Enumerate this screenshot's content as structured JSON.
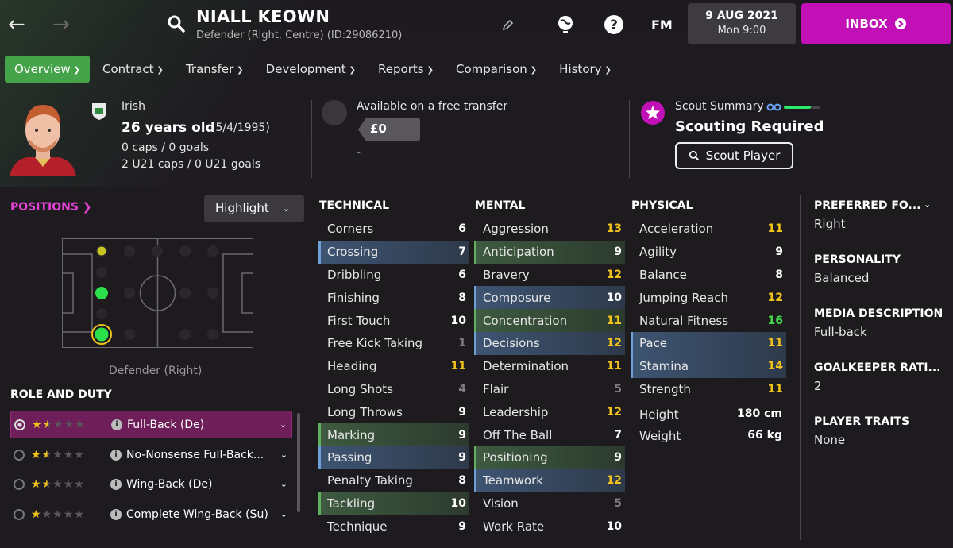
{
  "header": {
    "name": "NIALL KEOWN",
    "subtitle": "Defender (Right, Centre) (ID:29086210)",
    "fm_label": "FM",
    "date": "9 AUG 2021",
    "time": "Mon 9:00",
    "inbox": "INBOX"
  },
  "tabs": [
    {
      "label": "Overview",
      "active": true
    },
    {
      "label": "Contract"
    },
    {
      "label": "Transfer"
    },
    {
      "label": "Development"
    },
    {
      "label": "Reports"
    },
    {
      "label": "Comparison"
    },
    {
      "label": "History"
    }
  ],
  "bio": {
    "nationality": "Irish",
    "age": "26 years old",
    "dob": "(5/4/1995)",
    "caps": "0 caps / 0 goals",
    "u21": "2 U21 caps / 0 U21 goals"
  },
  "transfer": {
    "status": "Available on a free transfer",
    "value": "£0",
    "dash": "-"
  },
  "scout": {
    "label": "Scout Summary",
    "status": "Scouting Required",
    "button": "Scout Player"
  },
  "positions": {
    "title": "POSITIONS",
    "highlight": "Highlight",
    "position_name": "Defender (Right)"
  },
  "roles": {
    "title": "ROLE AND DUTY",
    "items": [
      {
        "name": "Full-Back (De)",
        "stars": 1.5,
        "selected": true
      },
      {
        "name": "No-Nonsense Full-Back...",
        "stars": 1.5
      },
      {
        "name": "Wing-Back (De)",
        "stars": 1.5
      },
      {
        "name": "Complete Wing-Back (Su)",
        "stars": 1
      }
    ]
  },
  "technical": {
    "title": "TECHNICAL",
    "rows": [
      {
        "n": "Corners",
        "v": "6"
      },
      {
        "n": "Crossing",
        "v": "7",
        "h": "b"
      },
      {
        "n": "Dribbling",
        "v": "6"
      },
      {
        "n": "Finishing",
        "v": "8"
      },
      {
        "n": "First Touch",
        "v": "10"
      },
      {
        "n": "Free Kick Taking",
        "v": "1",
        "c": "d"
      },
      {
        "n": "Heading",
        "v": "11",
        "c": "y"
      },
      {
        "n": "Long Shots",
        "v": "4",
        "c": "d"
      },
      {
        "n": "Long Throws",
        "v": "9"
      },
      {
        "n": "Marking",
        "v": "9",
        "h": "g"
      },
      {
        "n": "Passing",
        "v": "9",
        "h": "b"
      },
      {
        "n": "Penalty Taking",
        "v": "8"
      },
      {
        "n": "Tackling",
        "v": "10",
        "h": "g"
      },
      {
        "n": "Technique",
        "v": "9"
      }
    ]
  },
  "mental": {
    "title": "MENTAL",
    "rows": [
      {
        "n": "Aggression",
        "v": "13",
        "c": "y"
      },
      {
        "n": "Anticipation",
        "v": "9",
        "h": "g"
      },
      {
        "n": "Bravery",
        "v": "12",
        "c": "y"
      },
      {
        "n": "Composure",
        "v": "10",
        "h": "b"
      },
      {
        "n": "Concentration",
        "v": "11",
        "c": "y",
        "h": "g"
      },
      {
        "n": "Decisions",
        "v": "12",
        "c": "y",
        "h": "b"
      },
      {
        "n": "Determination",
        "v": "11",
        "c": "y"
      },
      {
        "n": "Flair",
        "v": "5",
        "c": "d"
      },
      {
        "n": "Leadership",
        "v": "12",
        "c": "y"
      },
      {
        "n": "Off The Ball",
        "v": "7"
      },
      {
        "n": "Positioning",
        "v": "9",
        "h": "g"
      },
      {
        "n": "Teamwork",
        "v": "12",
        "c": "y",
        "h": "b"
      },
      {
        "n": "Vision",
        "v": "5",
        "c": "d"
      },
      {
        "n": "Work Rate",
        "v": "10"
      }
    ]
  },
  "physical": {
    "title": "PHYSICAL",
    "rows": [
      {
        "n": "Acceleration",
        "v": "11",
        "c": "y"
      },
      {
        "n": "Agility",
        "v": "9"
      },
      {
        "n": "Balance",
        "v": "8"
      },
      {
        "n": "Jumping Reach",
        "v": "12",
        "c": "y"
      },
      {
        "n": "Natural Fitness",
        "v": "16",
        "c": "g"
      },
      {
        "n": "Pace",
        "v": "11",
        "c": "y",
        "h": "b"
      },
      {
        "n": "Stamina",
        "v": "14",
        "c": "y",
        "h": "b"
      },
      {
        "n": "Strength",
        "v": "11",
        "c": "y"
      }
    ],
    "height_label": "Height",
    "height": "180 cm",
    "weight_label": "Weight",
    "weight": "66 kg"
  },
  "side": {
    "foot_label": "PREFERRED FO...",
    "foot": "Right",
    "personality_label": "PERSONALITY",
    "personality": "Balanced",
    "media_label": "MEDIA DESCRIPTION",
    "media": "Full-back",
    "gk_label": "GOALKEEPER RATI...",
    "gk": "2",
    "traits_label": "PLAYER TRAITS",
    "traits": "None"
  }
}
